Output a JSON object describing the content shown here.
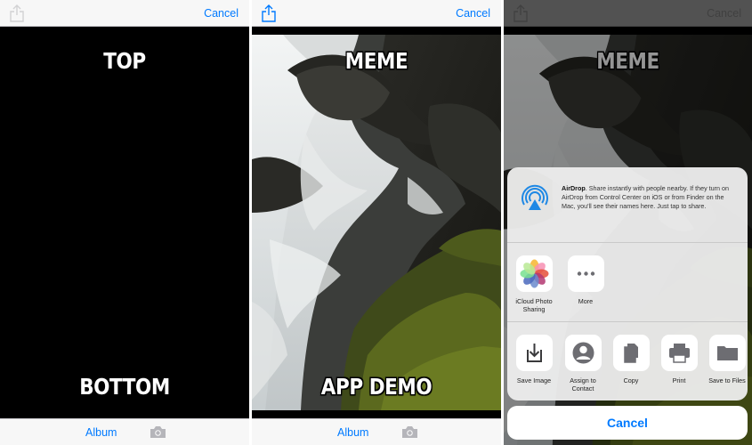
{
  "screen1": {
    "cancel_label": "Cancel",
    "top_text": "TOP",
    "bottom_text": "BOTTOM",
    "album_label": "Album"
  },
  "screen2": {
    "cancel_label": "Cancel",
    "top_text": "MEME",
    "bottom_text": "APP DEMO",
    "album_label": "Album"
  },
  "screen3": {
    "cancel_label": "Cancel",
    "top_text": "MEME",
    "share_sheet": {
      "airdrop_title": "AirDrop",
      "airdrop_text": ". Share instantly with people nearby. If they turn on AirDrop from Control Center on iOS or from Finder on the Mac, you'll see their names here. Just tap to share.",
      "apps": [
        {
          "label": "iCloud Photo Sharing",
          "icon": "photos-icon"
        },
        {
          "label": "More",
          "icon": "more-icon"
        }
      ],
      "actions": [
        {
          "label": "Save Image",
          "icon": "save-image-icon"
        },
        {
          "label": "Assign to Contact",
          "icon": "contact-icon"
        },
        {
          "label": "Copy",
          "icon": "copy-icon"
        },
        {
          "label": "Print",
          "icon": "print-icon"
        },
        {
          "label": "Save to Files",
          "icon": "folder-icon"
        }
      ],
      "cancel_label": "Cancel"
    }
  },
  "colors": {
    "accent": "#007aff",
    "bar_background": "#f7f7f7",
    "disabled": "#c7c7cc"
  }
}
